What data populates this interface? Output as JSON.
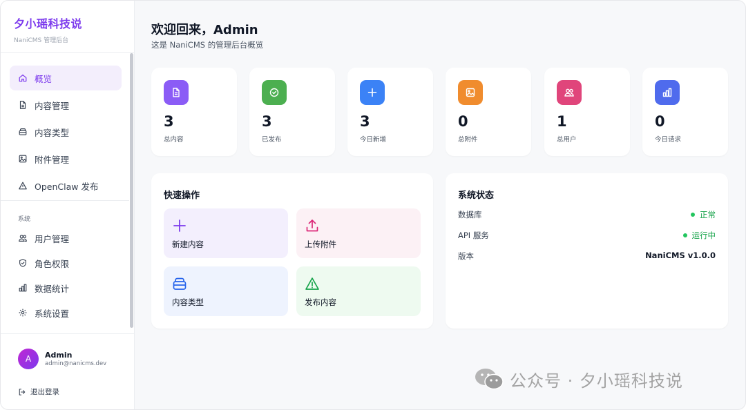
{
  "brand": {
    "title": "夕小瑶科技说",
    "subtitle": "NaniCMS 管理后台"
  },
  "sidebar": {
    "items": [
      {
        "label": "概览",
        "icon": "home-icon"
      },
      {
        "label": "内容管理",
        "icon": "document-icon"
      },
      {
        "label": "内容类型",
        "icon": "layers-icon"
      },
      {
        "label": "附件管理",
        "icon": "image-icon"
      },
      {
        "label": "OpenClaw 发布",
        "icon": "warning-triangle-icon"
      }
    ],
    "section_label": "系统",
    "system_items": [
      {
        "label": "用户管理",
        "icon": "users-icon"
      },
      {
        "label": "角色权限",
        "icon": "shield-icon"
      },
      {
        "label": "数据统计",
        "icon": "bar-chart-icon"
      },
      {
        "label": "系统设置",
        "icon": "gear-icon"
      }
    ]
  },
  "user": {
    "avatar_letter": "A",
    "name": "Admin",
    "email": "admin@nanicms.dev",
    "logout_label": "退出登录"
  },
  "header": {
    "title": "欢迎回来，Admin",
    "subtitle": "这是 NaniCMS 的管理后台概览"
  },
  "stats": [
    {
      "value": "3",
      "label": "总内容",
      "icon": "document-icon",
      "color": "#8b5cf6"
    },
    {
      "value": "3",
      "label": "已发布",
      "icon": "check-circle-icon",
      "color": "#4caf50"
    },
    {
      "value": "3",
      "label": "今日新增",
      "icon": "plus-icon",
      "color": "#3b82f6"
    },
    {
      "value": "0",
      "label": "总附件",
      "icon": "image-icon",
      "color": "#f08c2e"
    },
    {
      "value": "1",
      "label": "总用户",
      "icon": "users-icon",
      "color": "#e0457b"
    },
    {
      "value": "0",
      "label": "今日请求",
      "icon": "bar-chart-icon",
      "color": "#4f6bed"
    }
  ],
  "quick_actions": {
    "title": "快速操作",
    "items": [
      {
        "label": "新建内容",
        "icon": "plus-icon",
        "color": "#7c3aed",
        "bg": "#f3effd"
      },
      {
        "label": "上传附件",
        "icon": "upload-icon",
        "color": "#db2777",
        "bg": "#fcf1f5"
      },
      {
        "label": "内容类型",
        "icon": "layers-icon",
        "color": "#2563eb",
        "bg": "#eef3fe"
      },
      {
        "label": "发布内容",
        "icon": "warning-triangle-icon",
        "color": "#16a34a",
        "bg": "#eefaf0"
      }
    ]
  },
  "system_status": {
    "title": "系统状态",
    "rows": [
      {
        "key": "数据库",
        "value": "正常"
      },
      {
        "key": "API 服务",
        "value": "运行中"
      },
      {
        "key": "版本",
        "value": "NaniCMS v1.0.0"
      }
    ]
  },
  "watermark": "公众号 · 夕小瑶科技说"
}
